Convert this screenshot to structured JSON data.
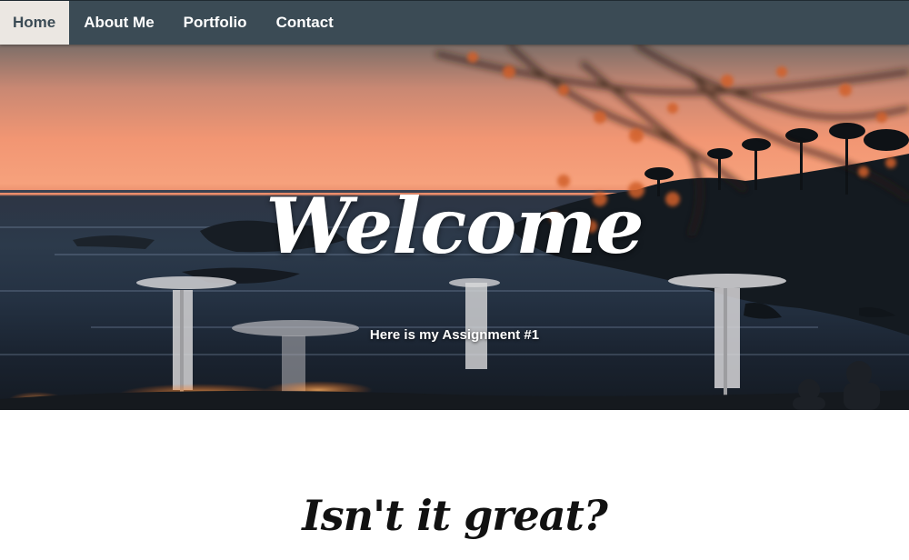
{
  "nav": {
    "items": [
      {
        "label": "Home",
        "active": true
      },
      {
        "label": "About Me",
        "active": false
      },
      {
        "label": "Portfolio",
        "active": false
      },
      {
        "label": "Contact",
        "active": false
      }
    ]
  },
  "hero": {
    "title": "Welcome",
    "subtitle": "Here is my Assignment #1"
  },
  "section": {
    "heading": "Isn't it great?"
  },
  "colors": {
    "navbar": "#3b4b55",
    "nav_active_bg": "#ebe7e2",
    "nav_text": "#ffffff",
    "page_bg": "#ffffff"
  }
}
